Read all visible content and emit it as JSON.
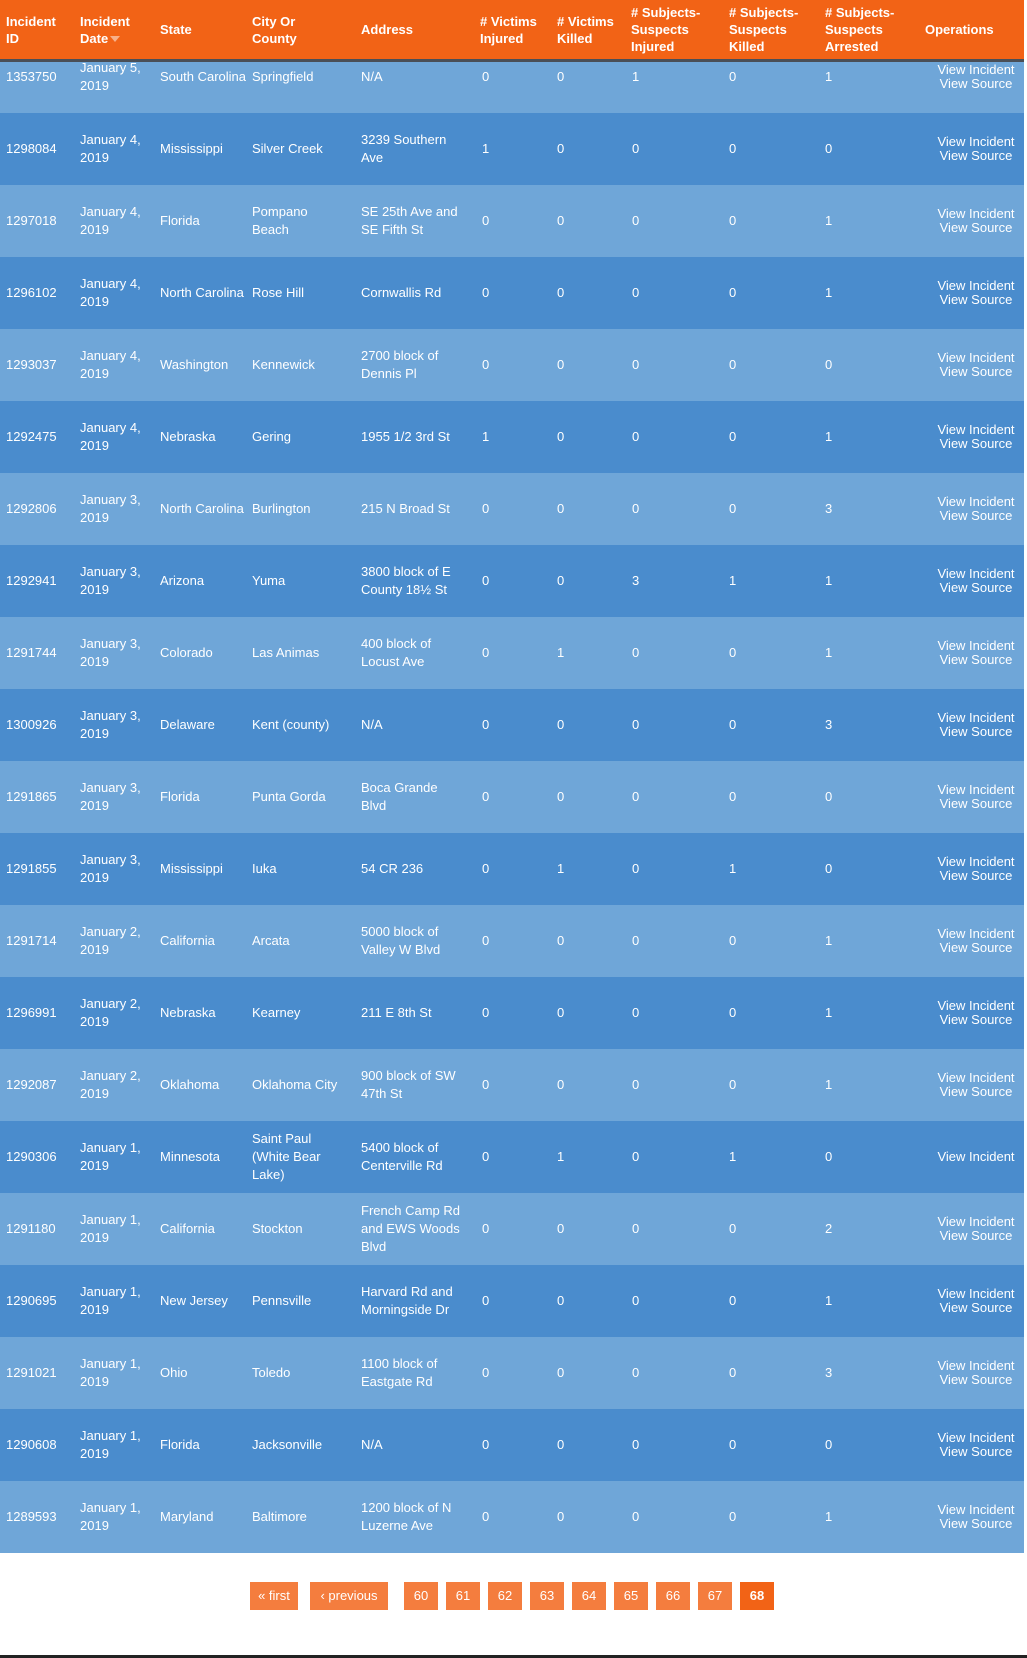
{
  "table": {
    "headers": {
      "incident_id": "Incident ID",
      "incident_date": "Incident Date",
      "state": "State",
      "city": "City Or County",
      "address": "Address",
      "victims_injured": "# Victims Injured",
      "victims_killed": "# Victims Killed",
      "suspects_injured": "# Subjects-Suspects Injured",
      "suspects_killed": "# Subjects-Suspects Killed",
      "suspects_arrested": "# Subjects-Suspects Arrested",
      "operations": "Operations"
    },
    "sorted_column": "incident_date",
    "sort_direction": "descending",
    "operation_labels": {
      "view_incident": "View Incident",
      "view_source": "View Source"
    },
    "colors": {
      "header_bg": "#f26316",
      "row_light": "#6fa6d8",
      "row_dark": "#4a8ccd",
      "pager_button": "#f47d3e"
    },
    "rows": [
      {
        "id": "1353750",
        "date": "January 5, 2019",
        "state": "South Carolina",
        "city": "Springfield",
        "address": "N/A",
        "vi": "0",
        "vk": "0",
        "si": "1",
        "sk": "0",
        "sa": "1",
        "has_source": true
      },
      {
        "id": "1298084",
        "date": "January 4, 2019",
        "state": "Mississippi",
        "city": "Silver Creek",
        "address": "3239 Southern Ave",
        "vi": "1",
        "vk": "0",
        "si": "0",
        "sk": "0",
        "sa": "0",
        "has_source": true
      },
      {
        "id": "1297018",
        "date": "January 4, 2019",
        "state": "Florida",
        "city": "Pompano Beach",
        "address": "SE 25th Ave and SE Fifth St",
        "vi": "0",
        "vk": "0",
        "si": "0",
        "sk": "0",
        "sa": "1",
        "has_source": true
      },
      {
        "id": "1296102",
        "date": "January 4, 2019",
        "state": "North Carolina",
        "city": "Rose Hill",
        "address": "Cornwallis Rd",
        "vi": "0",
        "vk": "0",
        "si": "0",
        "sk": "0",
        "sa": "1",
        "has_source": true
      },
      {
        "id": "1293037",
        "date": "January 4, 2019",
        "state": "Washington",
        "city": "Kennewick",
        "address": "2700 block of Dennis Pl",
        "vi": "0",
        "vk": "0",
        "si": "0",
        "sk": "0",
        "sa": "0",
        "has_source": true
      },
      {
        "id": "1292475",
        "date": "January 4, 2019",
        "state": "Nebraska",
        "city": "Gering",
        "address": "1955 1/2 3rd St",
        "vi": "1",
        "vk": "0",
        "si": "0",
        "sk": "0",
        "sa": "1",
        "has_source": true
      },
      {
        "id": "1292806",
        "date": "January 3, 2019",
        "state": "North Carolina",
        "city": "Burlington",
        "address": "215 N Broad St",
        "vi": "0",
        "vk": "0",
        "si": "0",
        "sk": "0",
        "sa": "3",
        "has_source": true
      },
      {
        "id": "1292941",
        "date": "January 3, 2019",
        "state": "Arizona",
        "city": "Yuma",
        "address": "3800 block of E County 18½ St",
        "vi": "0",
        "vk": "0",
        "si": "3",
        "sk": "1",
        "sa": "1",
        "has_source": true
      },
      {
        "id": "1291744",
        "date": "January 3, 2019",
        "state": "Colorado",
        "city": "Las Animas",
        "address": "400 block of Locust Ave",
        "vi": "0",
        "vk": "1",
        "si": "0",
        "sk": "0",
        "sa": "1",
        "has_source": true
      },
      {
        "id": "1300926",
        "date": "January 3, 2019",
        "state": "Delaware",
        "city": "Kent (county)",
        "address": "N/A",
        "vi": "0",
        "vk": "0",
        "si": "0",
        "sk": "0",
        "sa": "3",
        "has_source": true
      },
      {
        "id": "1291865",
        "date": "January 3, 2019",
        "state": "Florida",
        "city": "Punta Gorda",
        "address": "Boca Grande Blvd",
        "vi": "0",
        "vk": "0",
        "si": "0",
        "sk": "0",
        "sa": "0",
        "has_source": true
      },
      {
        "id": "1291855",
        "date": "January 3, 2019",
        "state": "Mississippi",
        "city": "Iuka",
        "address": "54 CR 236",
        "vi": "0",
        "vk": "1",
        "si": "0",
        "sk": "1",
        "sa": "0",
        "has_source": true
      },
      {
        "id": "1291714",
        "date": "January 2, 2019",
        "state": "California",
        "city": "Arcata",
        "address": "5000 block of Valley W Blvd",
        "vi": "0",
        "vk": "0",
        "si": "0",
        "sk": "0",
        "sa": "1",
        "has_source": true
      },
      {
        "id": "1296991",
        "date": "January 2, 2019",
        "state": "Nebraska",
        "city": "Kearney",
        "address": "211 E 8th St",
        "vi": "0",
        "vk": "0",
        "si": "0",
        "sk": "0",
        "sa": "1",
        "has_source": true
      },
      {
        "id": "1292087",
        "date": "January 2, 2019",
        "state": "Oklahoma",
        "city": "Oklahoma City",
        "address": "900 block of SW 47th St",
        "vi": "0",
        "vk": "0",
        "si": "0",
        "sk": "0",
        "sa": "1",
        "has_source": true
      },
      {
        "id": "1290306",
        "date": "January 1, 2019",
        "state": "Minnesota",
        "city": "Saint Paul (White Bear Lake)",
        "address": "5400 block of Centerville Rd",
        "vi": "0",
        "vk": "1",
        "si": "0",
        "sk": "1",
        "sa": "0",
        "has_source": false
      },
      {
        "id": "1291180",
        "date": "January 1, 2019",
        "state": "California",
        "city": "Stockton",
        "address": "French Camp Rd and EWS Woods Blvd",
        "vi": "0",
        "vk": "0",
        "si": "0",
        "sk": "0",
        "sa": "2",
        "has_source": true
      },
      {
        "id": "1290695",
        "date": "January 1, 2019",
        "state": "New Jersey",
        "city": "Pennsville",
        "address": "Harvard Rd and Morningside Dr",
        "vi": "0",
        "vk": "0",
        "si": "0",
        "sk": "0",
        "sa": "1",
        "has_source": true
      },
      {
        "id": "1291021",
        "date": "January 1, 2019",
        "state": "Ohio",
        "city": "Toledo",
        "address": "1100 block of Eastgate Rd",
        "vi": "0",
        "vk": "0",
        "si": "0",
        "sk": "0",
        "sa": "3",
        "has_source": true
      },
      {
        "id": "1290608",
        "date": "January 1, 2019",
        "state": "Florida",
        "city": "Jacksonville",
        "address": "N/A",
        "vi": "0",
        "vk": "0",
        "si": "0",
        "sk": "0",
        "sa": "0",
        "has_source": true
      },
      {
        "id": "1289593",
        "date": "January 1, 2019",
        "state": "Maryland",
        "city": "Baltimore",
        "address": "1200 block of N Luzerne Ave",
        "vi": "0",
        "vk": "0",
        "si": "0",
        "sk": "0",
        "sa": "1",
        "has_source": true
      }
    ]
  },
  "pager": {
    "first": "« first",
    "previous": "‹ previous",
    "pages": [
      "60",
      "61",
      "62",
      "63",
      "64",
      "65",
      "66",
      "67",
      "68"
    ],
    "current": "68"
  }
}
